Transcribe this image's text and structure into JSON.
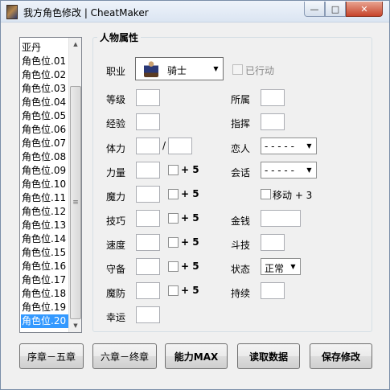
{
  "window": {
    "title": "我方角色修改 | CheatMaker",
    "minimize_glyph": "—",
    "maximize_glyph": "□",
    "close_glyph": "✕"
  },
  "character_list": {
    "items": [
      "亚丹",
      "角色位.01",
      "角色位.02",
      "角色位.03",
      "角色位.04",
      "角色位.05",
      "角色位.06",
      "角色位.07",
      "角色位.08",
      "角色位.09",
      "角色位.10",
      "角色位.11",
      "角色位.12",
      "角色位.13",
      "角色位.14",
      "角色位.15",
      "角色位.16",
      "角色位.17",
      "角色位.18",
      "角色位.19",
      "角色位.20"
    ],
    "selected_index": 20,
    "scroll_up_glyph": "▲",
    "scroll_down_glyph": "▼",
    "scroll_grip_glyph": "≡"
  },
  "attributes": {
    "group_title": "人物属性",
    "class_label": "职业",
    "class_value": "骑士",
    "acted_label": "已行动",
    "acted_checked": false,
    "level_label": "等级",
    "exp_label": "经验",
    "hp_label": "体力",
    "hp_separator": "/",
    "str_label": "力量",
    "mag_label": "魔力",
    "skl_label": "技巧",
    "spd_label": "速度",
    "def_label": "守备",
    "res_label": "魔防",
    "luck_label": "幸运",
    "plus5_label": "+ 5",
    "affiliation_label": "所属",
    "command_label": "指挥",
    "lover_label": "恋人",
    "lover_value": "- - - - -",
    "talk_label": "会话",
    "talk_value": "- - - - -",
    "move_label": "移动 + 3",
    "gold_label": "金钱",
    "arena_label": "斗技",
    "status_label": "状态",
    "status_value": "正常",
    "duration_label": "持续",
    "combo_arrow_glyph": "▼"
  },
  "buttons": {
    "prologue_to_ch5": "序章－五章",
    "ch6_to_final": "六章－终章",
    "ability_max": "能力MAX",
    "read_data": "读取数据",
    "save_changes": "保存修改"
  }
}
